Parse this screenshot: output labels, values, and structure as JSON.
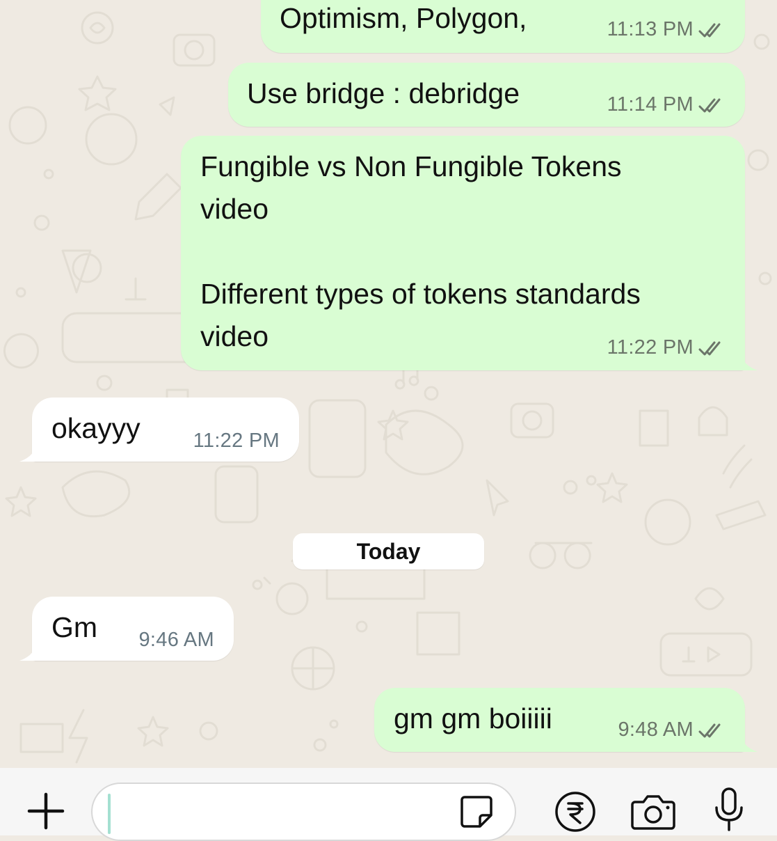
{
  "chat": {
    "messages": [
      {
        "id": "m1",
        "direction": "outgoing",
        "text": "Optimism, Polygon,",
        "time": "11:13 PM",
        "status": "read"
      },
      {
        "id": "m2",
        "direction": "outgoing",
        "text": "Use bridge : debridge",
        "time": "11:14 PM",
        "status": "read"
      },
      {
        "id": "m3",
        "direction": "outgoing",
        "text": "Fungible vs Non Fungible Tokens\nvideo\n\nDifferent types of tokens standards\nvideo",
        "time": "11:22 PM",
        "status": "read"
      },
      {
        "id": "m4",
        "direction": "incoming",
        "text": "okayyy",
        "time": "11:22 PM"
      },
      {
        "id": "m5",
        "direction": "incoming",
        "text": "Gm",
        "time": "9:46 AM"
      },
      {
        "id": "m6",
        "direction": "outgoing",
        "text": "gm gm boiiiii",
        "time": "9:48 AM",
        "status": "read"
      }
    ],
    "date_separator": "Today"
  },
  "input_bar": {
    "placeholder": "",
    "value": "",
    "icons": [
      "plus-icon",
      "sticker-icon",
      "rupee-payment-icon",
      "camera-icon",
      "microphone-icon"
    ]
  },
  "colors": {
    "chat_background": "#efeae2",
    "outgoing_bubble": "#d9fdd3",
    "incoming_bubble": "#ffffff",
    "read_ticks": "#6b7569",
    "caret": "#a4e0d1"
  }
}
